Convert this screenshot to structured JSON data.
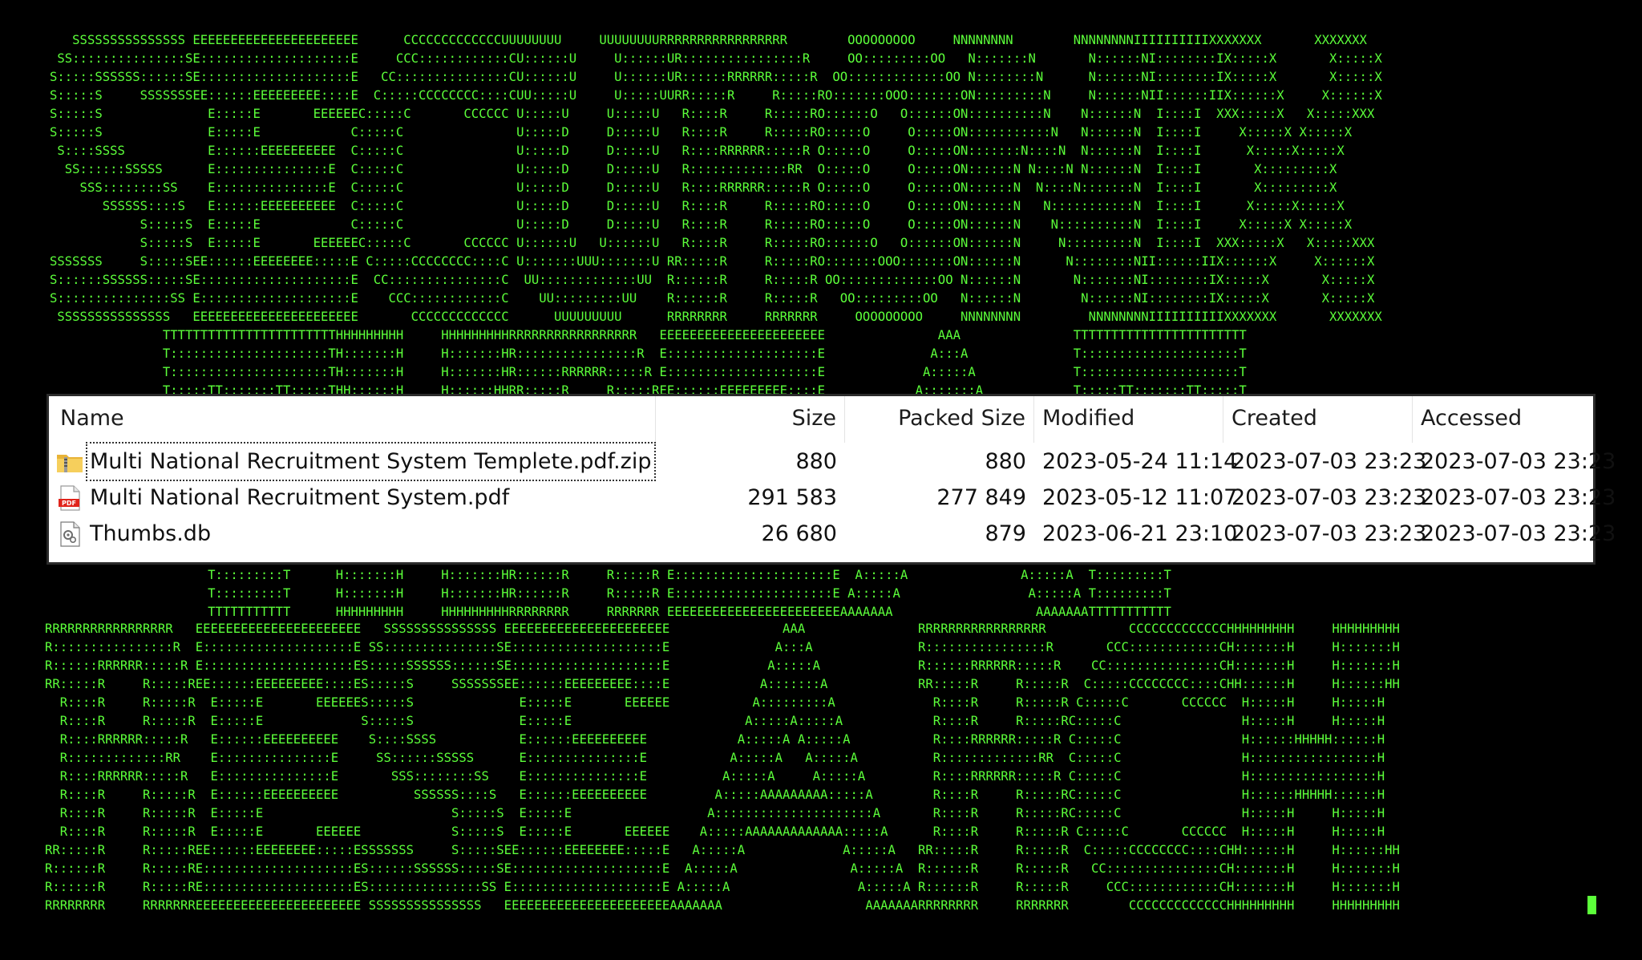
{
  "terminal": {
    "text_color": "#5CFF3A",
    "background": "#000000",
    "banner_top": "   SSSSSSSSSSSSSSS EEEEEEEEEEEEEEEEEEEEEE      CCCCCCCCCCCCCUUUUUUUU     UUUUUUUURRRRRRRRRRRRRRRRR        OOOOOOOOO     NNNNNNNN        NNNNNNNNIIIIIIIIIIXXXXXXX       XXXXXXX\n SS:::::::::::::::SE::::::::::::::::::::E     CCC::::::::::::CU::::::U     U::::::UR::::::::::::::::R     OO:::::::::OO   N:::::::N       N::::::NI::::::::IX:::::X       X:::::X\nS:::::SSSSSS::::::SE::::::::::::::::::::E   CC:::::::::::::::CU::::::U     U::::::UR::::::RRRRRR:::::R  OO:::::::::::::OO N::::::::N      N::::::NI::::::::IX:::::X       X:::::X\nS:::::S     SSSSSSSEE::::::EEEEEEEEE::::E  C:::::CCCCCCCC::::CUU:::::U     U:::::UURR:::::R     R:::::RO:::::::OOO:::::::ON:::::::::N     N::::::NII::::::IIX::::::X     X::::::X\nS:::::S              E:::::E       EEEEEEC:::::C       CCCCCC U:::::U     U:::::U   R::::R     R:::::RO::::::O   O::::::ON::::::::::N    N::::::N  I::::I  XXX:::::X   X:::::XXX\nS:::::S              E:::::E            C:::::C               U:::::D     D:::::U   R::::R     R:::::RO:::::O     O:::::ON:::::::::::N   N::::::N  I::::I     X:::::X X:::::X\n S::::SSSS           E::::::EEEEEEEEEE  C:::::C               U:::::D     D:::::U   R::::RRRRRR:::::R O:::::O     O:::::ON:::::::N::::N  N::::::N  I::::I      X:::::X:::::X\n  SS::::::SSSSS      E:::::::::::::::E  C:::::C               U:::::D     D:::::U   R:::::::::::::RR  O:::::O     O:::::ON::::::N N::::N N::::::N  I::::I       X:::::::::X\n    SSS::::::::SS    E:::::::::::::::E  C:::::C               U:::::D     D:::::U   R::::RRRRRR:::::R O:::::O     O:::::ON::::::N  N::::N:::::::N  I::::I       X:::::::::X\n       SSSSSS::::S   E::::::EEEEEEEEEE  C:::::C               U:::::D     D:::::U   R::::R     R:::::RO:::::O     O:::::ON::::::N   N:::::::::::N  I::::I      X:::::X:::::X\n            S:::::S  E:::::E            C:::::C               U:::::D     D:::::U   R::::R     R:::::RO:::::O     O:::::ON::::::N    N::::::::::N  I::::I     X:::::X X:::::X\n            S:::::S  E:::::E       EEEEEEC:::::C       CCCCCC U::::::U   U::::::U   R::::R     R:::::RO::::::O   O::::::ON::::::N     N:::::::::N  I::::I  XXX:::::X   X:::::XXX\nSSSSSSS     S:::::SEE::::::EEEEEEEE:::::E C:::::CCCCCCCC::::C U:::::::UUU:::::::U RR:::::R     R:::::RO:::::::OOO:::::::ON::::::N      N::::::::NII::::::IIX::::::X     X::::::X\nS::::::SSSSSS:::::SE::::::::::::::::::::E  CC:::::::::::::::C  UU:::::::::::::UU  R::::::R     R:::::R OO:::::::::::::OO N::::::N       N:::::::NI::::::::IX:::::X       X:::::X\nS:::::::::::::::SS E::::::::::::::::::::E    CCC::::::::::::C    UU:::::::::UU    R::::::R     R:::::R   OO:::::::::OO   N::::::N        N::::::NI::::::::IX:::::X       X:::::X\n SSSSSSSSSSSSSSS   EEEEEEEEEEEEEEEEEEEEEE       CCCCCCCCCCCCC      UUUUUUUUU      RRRRRRRR     RRRRRRR     OOOOOOOOO     NNNNNNNN         NNNNNNNNIIIIIIIIIIXXXXXXX       XXXXXXX\n               TTTTTTTTTTTTTTTTTTTTTTTHHHHHHHHH     HHHHHHHHHRRRRRRRRRRRRRRRRR   EEEEEEEEEEEEEEEEEEEEEE               AAA               TTTTTTTTTTTTTTTTTTTTTTT\n               T:::::::::::::::::::::TH:::::::H     H:::::::HR::::::::::::::::R  E::::::::::::::::::::E              A:::A              T:::::::::::::::::::::T\n               T:::::::::::::::::::::TH:::::::H     H:::::::HR::::::RRRRRR:::::R E::::::::::::::::::::E             A:::::A             T:::::::::::::::::::::T\n               T:::::TT:::::::TT:::::THH::::::H     H::::::HHRR:::::R     R:::::REE::::::EEEEEEEEE::::E            A:::::::A            T:::::TT:::::::TT:::::T",
    "banner_mid": "                     T:::::::::T      H:::::::H     H:::::::HR::::::R     R:::::R E:::::::::::::::::::::E  A:::::A               A:::::A  T:::::::::T\n                     T:::::::::T      H:::::::H     H:::::::HR::::::R     R:::::R E:::::::::::::::::::::E A:::::A                 A:::::A T:::::::::T\n                     TTTTTTTTTTT      HHHHHHHHH     HHHHHHHHHRRRRRRRR     RRRRRRR EEEEEEEEEEEEEEEEEEEEEEEAAAAAAA                   AAAAAAATTTTTTTTTTT",
    "banner_bottom": "RRRRRRRRRRRRRRRRR   EEEEEEEEEEEEEEEEEEEEEE   SSSSSSSSSSSSSSS EEEEEEEEEEEEEEEEEEEEEE               AAA               RRRRRRRRRRRRRRRRR           CCCCCCCCCCCCCHHHHHHHHH     HHHHHHHHH\nR::::::::::::::::R  E::::::::::::::::::::E SS:::::::::::::::SE::::::::::::::::::::E              A:::A              R::::::::::::::::R       CCC::::::::::::CH:::::::H     H:::::::H\nR::::::RRRRRR:::::R E::::::::::::::::::::ES:::::SSSSSS::::::SE::::::::::::::::::::E             A:::::A             R::::::RRRRRR:::::R    CC:::::::::::::::CH:::::::H     H:::::::H\nRR:::::R     R:::::REE::::::EEEEEEEEE::::ES:::::S     SSSSSSSEE::::::EEEEEEEEE::::E            A:::::::A            RR:::::R     R:::::R  C:::::CCCCCCCC::::CHH::::::H     H::::::HH\n  R::::R     R:::::R  E:::::E       EEEEEES:::::S              E:::::E       EEEEEE           A:::::::::A             R::::R     R:::::R C:::::C       CCCCCC  H:::::H     H:::::H\n  R::::R     R:::::R  E:::::E             S:::::S              E:::::E                       A:::::A:::::A            R::::R     R:::::RC:::::C                H:::::H     H:::::H\n  R::::RRRRRR:::::R   E::::::EEEEEEEEEE    S::::SSSS           E::::::EEEEEEEEEE            A:::::A A:::::A           R::::RRRRRR:::::R C:::::C                H::::::HHHHH::::::H\n  R:::::::::::::RR    E:::::::::::::::E     SS::::::SSSSS      E:::::::::::::::E           A:::::A   A:::::A          R:::::::::::::RR  C:::::C                H:::::::::::::::::H\n  R::::RRRRRR:::::R   E:::::::::::::::E       SSS::::::::SS    E:::::::::::::::E          A:::::A     A:::::A         R::::RRRRRR:::::R C:::::C                H:::::::::::::::::H\n  R::::R     R:::::R  E::::::EEEEEEEEEE          SSSSSS::::S   E::::::EEEEEEEEEE         A:::::AAAAAAAAA:::::A        R::::R     R:::::RC:::::C                H::::::HHHHH::::::H\n  R::::R     R:::::R  E:::::E                         S:::::S  E:::::E                  A:::::::::::::::::::::A       R::::R     R:::::RC:::::C                H:::::H     H:::::H\n  R::::R     R:::::R  E:::::E       EEEEEE            S:::::S  E:::::E       EEEEEE    A:::::AAAAAAAAAAAAA:::::A      R::::R     R:::::R C:::::C       CCCCCC  H:::::H     H:::::H\nRR:::::R     R:::::REE::::::EEEEEEEE:::::ESSSSSSS     S:::::SEE::::::EEEEEEEE:::::E   A:::::A             A:::::A   RR:::::R     R:::::R  C:::::CCCCCCCC::::CHH::::::H     H::::::HH\nR::::::R     R:::::RE::::::::::::::::::::ES::::::SSSSSS:::::SE::::::::::::::::::::E  A:::::A               A:::::A  R::::::R     R:::::R   CC:::::::::::::::CH:::::::H     H:::::::H\nR::::::R     R:::::RE::::::::::::::::::::ES:::::::::::::::SS E::::::::::::::::::::E A:::::A                 A:::::A R::::::R     R:::::R     CCC::::::::::::CH:::::::H     H:::::::H\nRRRRRRRR     RRRRRRREEEEEEEEEEEEEEEEEEEEEE SSSSSSSSSSSSSSS   EEEEEEEEEEEEEEEEEEEEEEAAAAAAA                   AAAAAAARRRRRRRR     RRRRRRR        CCCCCCCCCCCCCHHHHHHHHH     HHHHHHHHH"
  },
  "file_list": {
    "columns": {
      "name": "Name",
      "size": "Size",
      "packed_size": "Packed Size",
      "modified": "Modified",
      "created": "Created",
      "accessed": "Accessed"
    },
    "rows": [
      {
        "icon": "zip-folder-icon",
        "name": "Multi National Recruitment System Templete.pdf.zip",
        "size": "880",
        "packed_size": "880",
        "modified": "2023-05-24 11:14",
        "created": "2023-07-03 23:23",
        "accessed": "2023-07-03 23:23"
      },
      {
        "icon": "pdf-icon",
        "name": "Multi National Recruitment System.pdf",
        "size": "291 583",
        "packed_size": "277 849",
        "modified": "2023-05-12 11:07",
        "created": "2023-07-03 23:23",
        "accessed": "2023-07-03 23:23"
      },
      {
        "icon": "system-file-icon",
        "name": "Thumbs.db",
        "size": "26 680",
        "packed_size": "879",
        "modified": "2023-06-21 23:10",
        "created": "2023-07-03 23:23",
        "accessed": "2023-07-03 23:23"
      }
    ]
  }
}
